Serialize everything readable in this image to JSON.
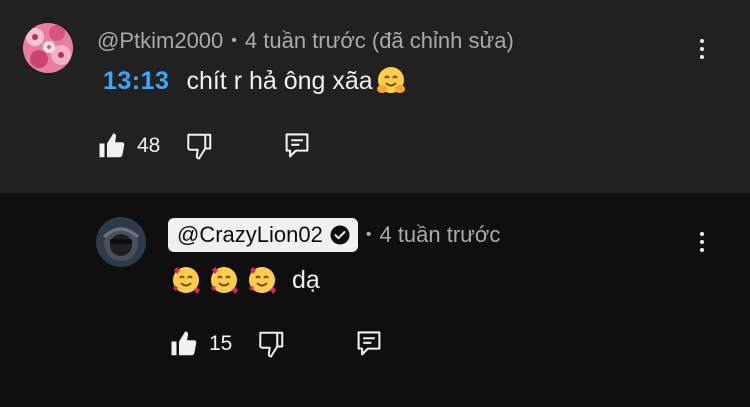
{
  "comments": [
    {
      "author": "@Ptkim2000",
      "time": "4 tuần trước (đã chỉnh sửa)",
      "timestamp_link": "13:13",
      "text": "chít r hả ông xãa",
      "likes": "48",
      "avatar_icon": "pink-flowers-avatar",
      "colors": {
        "avatar": "#e87fa0",
        "timestamp": "#3ea6ff"
      }
    },
    {
      "author": "@CrazyLion02",
      "time": "4 tuần trước",
      "text": "dạ",
      "likes": "15",
      "verified": true,
      "avatar_icon": "lion-avatar",
      "colors": {
        "avatar": "#2d3a4a"
      }
    }
  ],
  "separator": "•"
}
